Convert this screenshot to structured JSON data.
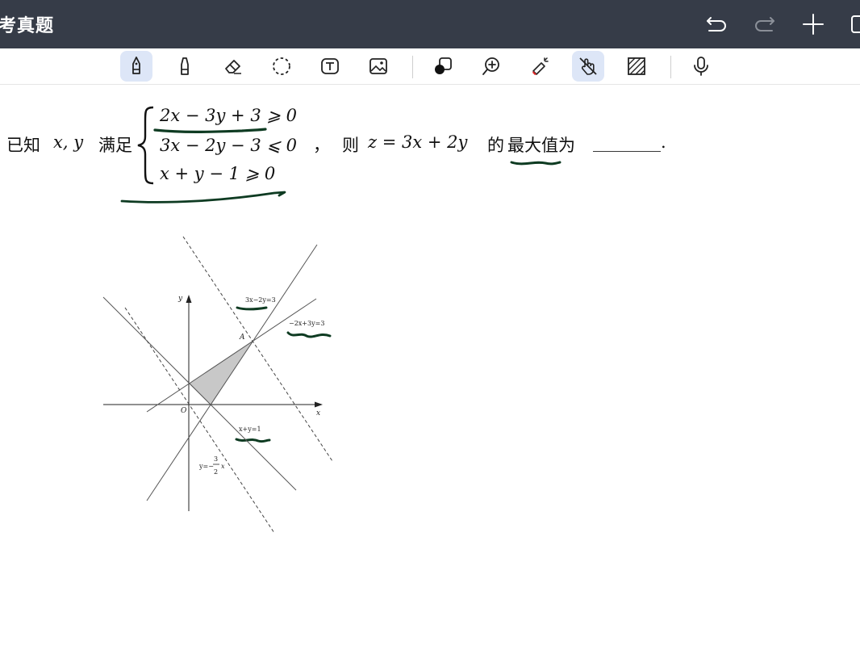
{
  "app": {
    "title": "考真题"
  },
  "titlebar_buttons": [
    {
      "name": "undo-button",
      "icon": "undo-icon"
    },
    {
      "name": "redo-button",
      "icon": "redo-icon"
    },
    {
      "name": "add-page-button",
      "icon": "plus-icon"
    },
    {
      "name": "pages-button",
      "icon": "pages-icon"
    }
  ],
  "toolbar": {
    "tools": [
      "pen",
      "highlighter",
      "eraser",
      "lasso-select",
      "text",
      "image",
      "shapes",
      "zoom",
      "laser-pointer",
      "touch-drawing",
      "hatch",
      "microphone"
    ],
    "active_tools": [
      "pen",
      "touch-drawing"
    ],
    "accent_color": "#dde6f7"
  },
  "problem": {
    "lead_1": "已知",
    "vars": "x, y",
    "lead_2": "满足",
    "ineq_1": "2x − 3y + 3 ⩾ 0",
    "ineq_2": "3x − 2y − 3 ⩽ 0",
    "ineq_3": "x + y − 1 ⩾ 0",
    "comma": "，",
    "then": "则",
    "objective": "z = 3x + 2y",
    "ask_1": "的",
    "ask_2": "最大值为",
    "blank": "________.",
    "annotation_color": "#0e3b22"
  },
  "figure": {
    "axis_x_label": "x",
    "axis_y_label": "y",
    "origin_label": "O",
    "point_label": "A",
    "line_1_label": "3x−2y=3",
    "line_2_label": "−2x+3y=3",
    "line_3_label": "x+y=1",
    "objective_line_prefix": "y=−",
    "objective_line_num": "3",
    "objective_line_den": "2",
    "objective_line_var": "x",
    "shade_color": "#c8c8c8"
  }
}
